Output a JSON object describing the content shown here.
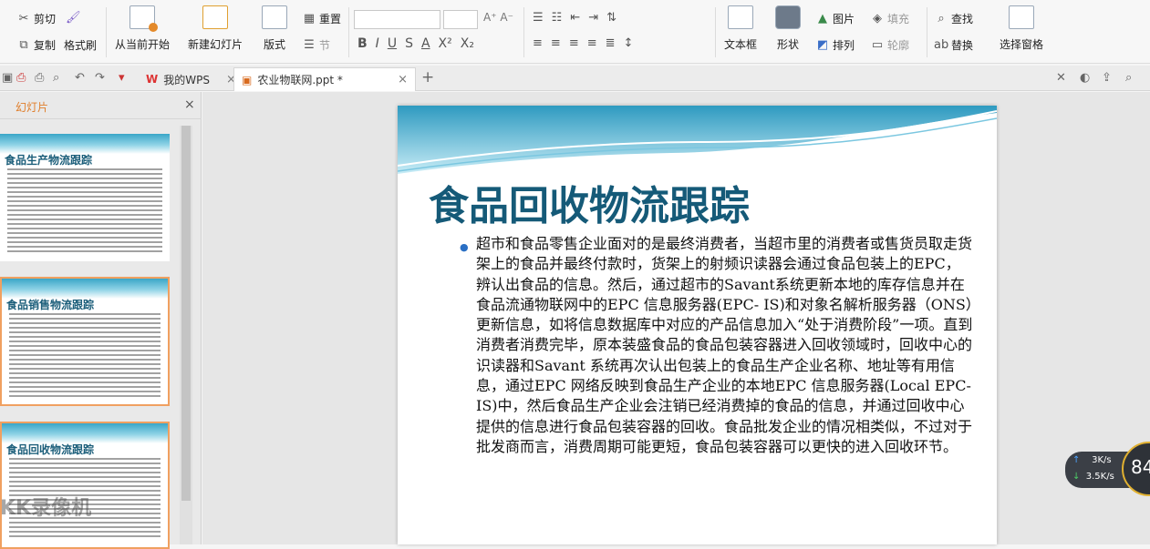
{
  "ribbon": {
    "cut": "剪切",
    "copy": "复制",
    "format_painter": "格式刷",
    "from_current": "从当前开始",
    "new_slide": "新建幻灯片",
    "layout": "版式",
    "reset": "重置",
    "section": "节",
    "text_box": "文本框",
    "shape": "形状",
    "picture": "图片",
    "fill": "填充",
    "find": "查找",
    "arrange": "排列",
    "outline": "轮廓",
    "replace": "替换",
    "selection_pane": "选择窗格"
  },
  "tabs": {
    "my_wps": "我的WPS",
    "doc": "农业物联网.ppt *"
  },
  "panel": {
    "title": "幻灯片",
    "thumbs": [
      "食品生产物流跟踪",
      "食品销售物流跟踪",
      "食品回收物流跟踪"
    ]
  },
  "slide": {
    "title": "食品回收物流跟踪",
    "body": "超市和食品零售企业面对的是最终消费者，当超市里的消费者或售货员取走货架上的食品并最终付款时，货架上的射频识读器会通过食品包装上的EPC，辨认出食品的信息。然后，通过超市的Savant系统更新本地的库存信息并在食品流通物联网中的EPC 信息服务器(EPC- IS)和对象名解析服务器（ONS）更新信息，如将信息数据库中对应的产品信息加入“处于消费阶段”一项。直到消费者消费完毕，原本装盛食品的食品包装容器进入回收领域时，回收中心的识读器和Savant 系统再次认出包装上的食品生产企业名称、地址等有用信息，通过EPC 网络反映到食品生产企业的本地EPC 信息服务器(Local EPC- IS)中，然后食品生产企业会注销已经消费掉的食品的信息，并通过回收中心提供的信息进行食品包装容器的回收。食品批发企业的情况相类似，不过对于批发商而言，消费周期可能更短，食品包装容器可以更快的进入回收环节。"
  },
  "network": {
    "up": "3K/s",
    "down": "3.5K/s",
    "gauge": "84"
  },
  "watermark": "KK录像机"
}
